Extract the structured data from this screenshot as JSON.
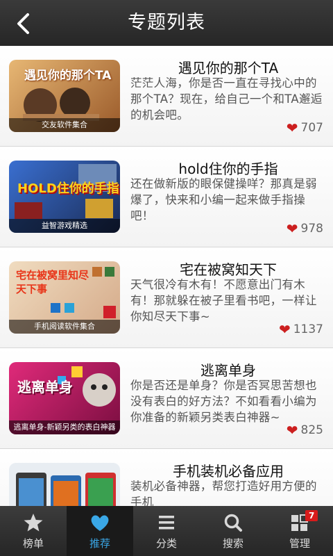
{
  "header": {
    "title": "专题列表"
  },
  "items": [
    {
      "title": "遇见你的那个TA",
      "desc": "茫茫人海，你是否一直在寻找心中的那个TA？现在，给自己一个和TA邂逅的机会吧。",
      "likes": "707",
      "thumb_caption": "交友软件集合",
      "thumb_text": "遇见你的那个TA",
      "thumb_color": "#c48a3a"
    },
    {
      "title": "hold住你的手指",
      "desc": "还在做新版的眼保健操咩？那真是弱爆了，快来和小编一起来做手指操吧！",
      "likes": "978",
      "thumb_caption": "益智游戏精选",
      "thumb_text": "HOLD住你的手指",
      "thumb_color": "#2a4f9c"
    },
    {
      "title": "宅在被窝知天下",
      "desc": "天气很冷有木有！不愿意出门有木有！那就躲在被子里看书吧，一样让你知尽天下事~",
      "likes": "1137",
      "thumb_caption": "手机阅读软件集合",
      "thumb_text": "宅在被窝里知尽天下事",
      "thumb_color": "#e6c9a3"
    },
    {
      "title": "逃离单身",
      "desc": "你是否还是单身？你是否冥思苦想也没有表白的好方法？不如看看小编为你准备的新颖另类表白神器~",
      "likes": "825",
      "thumb_caption": "逃离单身-新颖另类的表白神器",
      "thumb_text": "逃离单身",
      "thumb_color": "#c01a6a"
    },
    {
      "title": "手机装机必备应用",
      "desc": "装机必备神器，帮您打造好用方便的手机",
      "likes": "",
      "thumb_caption": "",
      "thumb_text": "",
      "thumb_color": "#dfe6ee"
    }
  ],
  "tabs": [
    {
      "label": "榜单",
      "icon": "star-icon"
    },
    {
      "label": "推荐",
      "icon": "heart-icon"
    },
    {
      "label": "分类",
      "icon": "list-icon"
    },
    {
      "label": "搜索",
      "icon": "search-icon"
    },
    {
      "label": "管理",
      "icon": "grid-icon",
      "badge": "7"
    }
  ],
  "colors": {
    "accent": "#3aa7e6",
    "heart": "#cc1f1f",
    "header": "#2e2e2e"
  }
}
